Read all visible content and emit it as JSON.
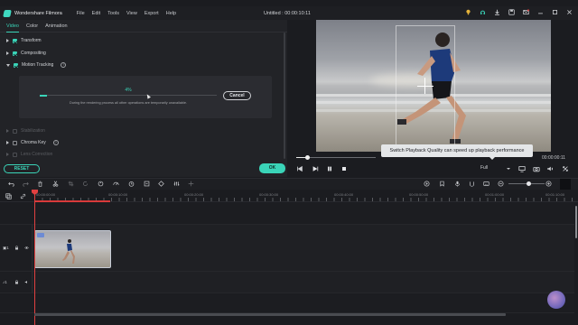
{
  "app": {
    "name": "Wondershare Filmora",
    "menus": [
      "File",
      "Edit",
      "Tools",
      "View",
      "Export",
      "Help"
    ],
    "project_title": "Untitled : 00:00:10:11",
    "titlebar_icons": [
      "bulb-icon",
      "headset-icon",
      "download-icon",
      "save-icon",
      "mail-icon",
      "minimize-icon",
      "maximize-icon",
      "close-icon"
    ]
  },
  "panel": {
    "tabs": [
      "Video",
      "Color",
      "Animation"
    ],
    "active_tab": "Video",
    "sections": {
      "transform": "Transform",
      "compositing": "Compositing",
      "motion_tracking": "Motion Tracking",
      "stabilization": "Stabilization",
      "chroma_key": "Chroma Key",
      "lens_correction": "Lens Correction"
    },
    "tracking": {
      "percent_label": "4%",
      "progress": 0.04,
      "cancel_label": "Cancel",
      "note": "During the rendering process all other operations are temporarily unavailable."
    },
    "reset_label": "RESET",
    "ok_label": "OK"
  },
  "preview": {
    "tooltip": "Switch Playback Quality can speed up playback performance",
    "time": "00:00:00:11",
    "quality": "Full",
    "scrub_progress": 0.04
  },
  "timeline": {
    "ruler": [
      "00:00:00:00",
      "00:00:10:00",
      "00:00:20:00",
      "00:00:30:00",
      "00:00:40:00",
      "00:00:50:00",
      "00:01:00:00",
      "00:01:10:00"
    ],
    "tracks": [
      {
        "label": "1",
        "type": "video"
      },
      {
        "label": "1",
        "type": "audio"
      }
    ]
  },
  "colors": {
    "accent": "#3ad4b8",
    "playhead": "#e04040",
    "background": "#1b1c20"
  }
}
